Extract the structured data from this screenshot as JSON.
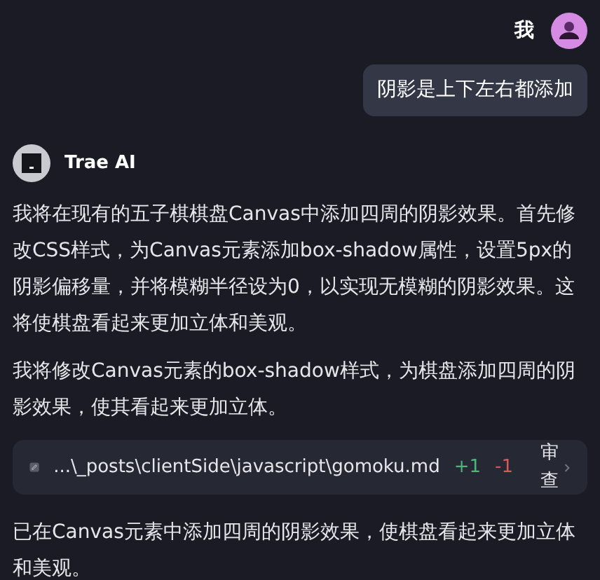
{
  "user": {
    "name": "我",
    "message": "阴影是上下左右都添加"
  },
  "assistant": {
    "name": "Trae AI",
    "paragraphs": [
      "我将在现有的五子棋棋盘Canvas中添加四周的阴影效果。首先修改CSS样式，为Canvas元素添加box-shadow属性，设置5px的阴影偏移量，并将模糊半径设为0，以实现无模糊的阴影效果。这将使棋盘看起来更加立体和美观。",
      "我将修改Canvas元素的box-shadow样式，为棋盘添加四周的阴影效果，使其看起来更加立体。"
    ],
    "file_change": {
      "path": "...\\_posts\\clientSide\\javascript\\gomoku.md",
      "added": "+1",
      "removed": "-1",
      "action": "审查"
    },
    "summary": "已在Canvas元素中添加四周的阴影效果，使棋盘看起来更加立体和美观。"
  }
}
